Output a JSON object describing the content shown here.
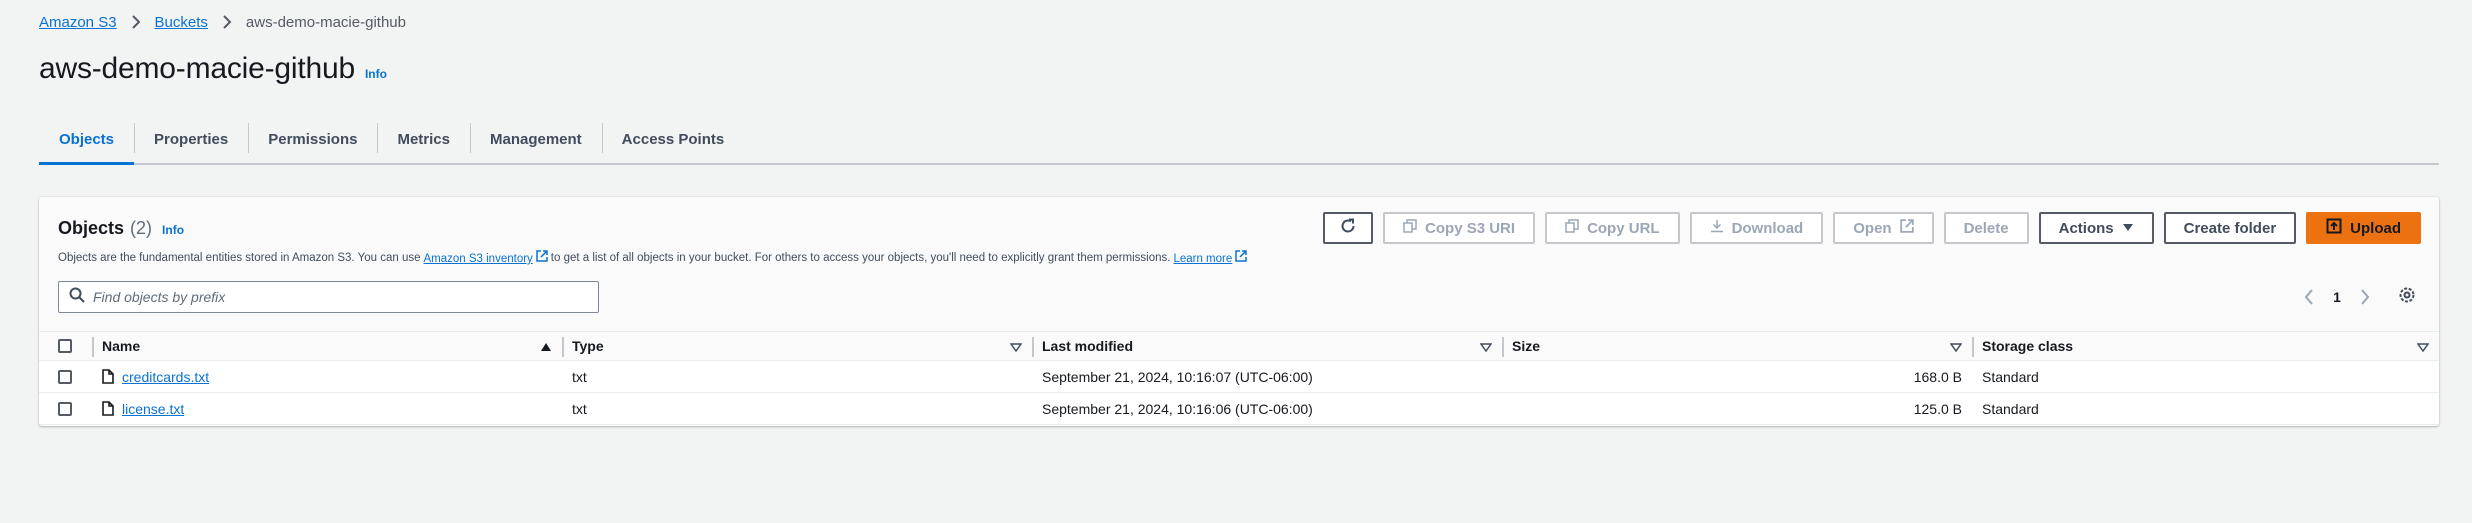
{
  "breadcrumb": {
    "items": [
      "Amazon S3",
      "Buckets"
    ],
    "current": "aws-demo-macie-github"
  },
  "page": {
    "title": "aws-demo-macie-github",
    "info": "Info"
  },
  "tabs": [
    {
      "label": "Objects",
      "active": true
    },
    {
      "label": "Properties"
    },
    {
      "label": "Permissions"
    },
    {
      "label": "Metrics"
    },
    {
      "label": "Management"
    },
    {
      "label": "Access Points"
    }
  ],
  "objects_panel": {
    "title": "Objects",
    "count": "(2)",
    "info": "Info",
    "description_1": "Objects are the fundamental entities stored in Amazon S3. You can use",
    "inventory_link": "Amazon S3 inventory",
    "description_2": "to get a list of all objects in your bucket. For others to access your objects, you'll need to explicitly grant them permissions.",
    "learn_more": "Learn more",
    "search_placeholder": "Find objects by prefix",
    "page_number": "1"
  },
  "toolbar": {
    "copy_s3_uri": "Copy S3 URI",
    "copy_url": "Copy URL",
    "download": "Download",
    "open": "Open",
    "delete": "Delete",
    "actions": "Actions",
    "create_folder": "Create folder",
    "upload": "Upload"
  },
  "table": {
    "columns": [
      "Name",
      "Type",
      "Last modified",
      "Size",
      "Storage class"
    ],
    "rows": [
      {
        "name": "creditcards.txt",
        "type": "txt",
        "last_modified": "September 21, 2024, 10:16:07 (UTC-06:00)",
        "size": "168.0 B",
        "storage_class": "Standard"
      },
      {
        "name": "license.txt",
        "type": "txt",
        "last_modified": "September 21, 2024, 10:16:06 (UTC-06:00)",
        "size": "125.0 B",
        "storage_class": "Standard"
      }
    ]
  },
  "colors": {
    "link": "#0972d3",
    "primary_button": "#ec7211",
    "background": "#f2f3f3"
  }
}
